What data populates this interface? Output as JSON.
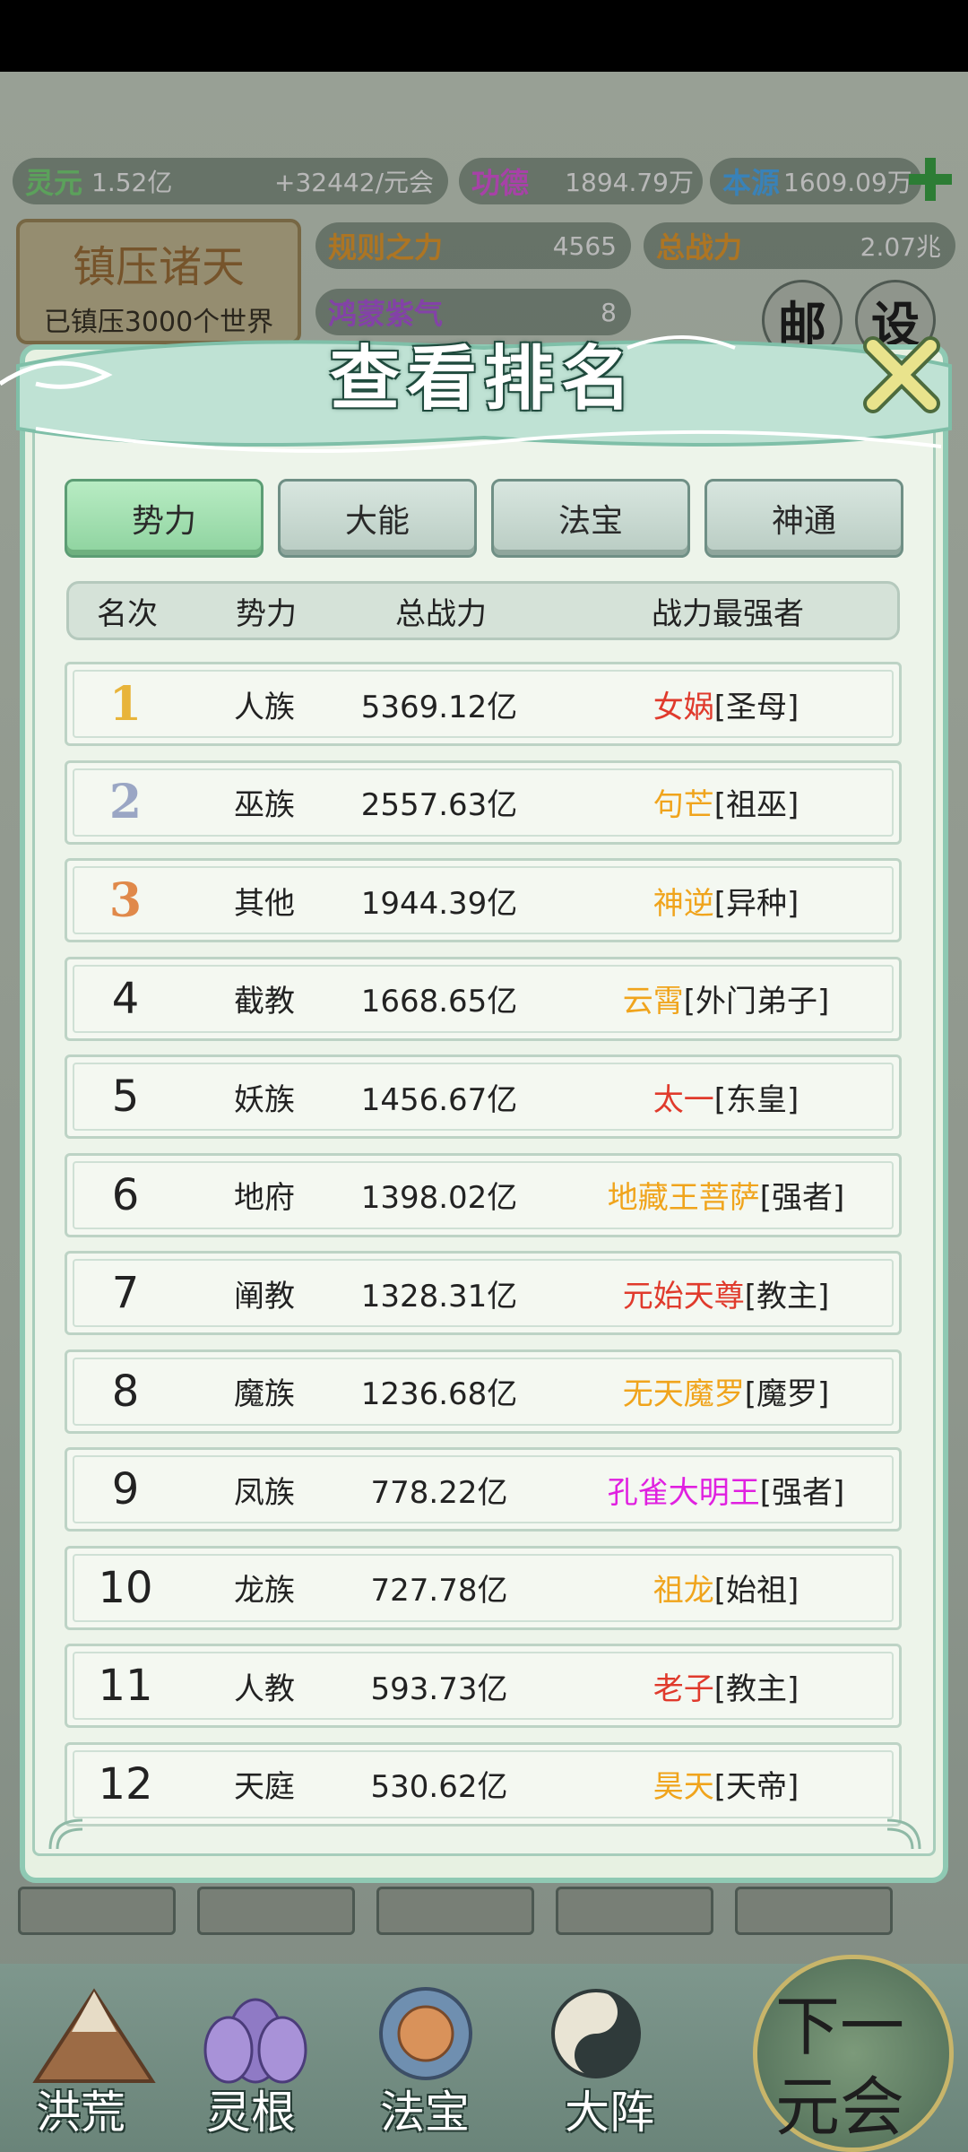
{
  "top_stats": {
    "lingyuan_label": "灵元",
    "lingyuan_value": "1.52亿",
    "lingyuan_rate": "+32442/元会",
    "gongde_label": "功德",
    "gongde_value": "1894.79万",
    "benyuan_label": "本源",
    "benyuan_value": "1609.09万",
    "guize_label": "规则之力",
    "guize_value": "4565",
    "zongzhanli_label": "总战力",
    "zongzhanli_value": "2.07兆",
    "hongmeng_label": "鸿蒙紫气",
    "hongmeng_value": "8"
  },
  "suppress_panel": {
    "title": "镇压诸天",
    "subtitle": "已镇压3000个世界"
  },
  "round_buttons": {
    "mail": "邮",
    "settings": "设"
  },
  "modal": {
    "title": "查看排名",
    "tabs": [
      "势力",
      "大能",
      "法宝",
      "神通"
    ],
    "active_tab": 0,
    "headers": {
      "rank": "名次",
      "force": "势力",
      "power": "总战力",
      "strongest": "战力最强者"
    },
    "rows": [
      {
        "rank": "1",
        "force": "人族",
        "power": "5369.12亿",
        "name": "女娲",
        "title": "[圣母]",
        "color": "#e03a2c"
      },
      {
        "rank": "2",
        "force": "巫族",
        "power": "2557.63亿",
        "name": "句芒",
        "title": "[祖巫]",
        "color": "#f0a41c"
      },
      {
        "rank": "3",
        "force": "其他",
        "power": "1944.39亿",
        "name": "神逆",
        "title": "[异种]",
        "color": "#f0a41c"
      },
      {
        "rank": "4",
        "force": "截教",
        "power": "1668.65亿",
        "name": "云霄",
        "title": "[外门弟子]",
        "color": "#f0a41c"
      },
      {
        "rank": "5",
        "force": "妖族",
        "power": "1456.67亿",
        "name": "太一",
        "title": "[东皇]",
        "color": "#e03a2c"
      },
      {
        "rank": "6",
        "force": "地府",
        "power": "1398.02亿",
        "name": "地藏王菩萨",
        "title": "[强者]",
        "color": "#f0a41c"
      },
      {
        "rank": "7",
        "force": "阐教",
        "power": "1328.31亿",
        "name": "元始天尊",
        "title": "[教主]",
        "color": "#e03a2c"
      },
      {
        "rank": "8",
        "force": "魔族",
        "power": "1236.68亿",
        "name": "无天魔罗",
        "title": "[魔罗]",
        "color": "#f0a41c"
      },
      {
        "rank": "9",
        "force": "凤族",
        "power": "778.22亿",
        "name": "孔雀大明王",
        "title": "[强者]",
        "color": "#e020e0"
      },
      {
        "rank": "10",
        "force": "龙族",
        "power": "727.78亿",
        "name": "祖龙",
        "title": "[始祖]",
        "color": "#f0a41c"
      },
      {
        "rank": "11",
        "force": "人教",
        "power": "593.73亿",
        "name": "老子",
        "title": "[教主]",
        "color": "#e03a2c"
      },
      {
        "rank": "12",
        "force": "天庭",
        "power": "530.62亿",
        "name": "昊天",
        "title": "[天帝]",
        "color": "#f0a41c"
      }
    ],
    "medal_colors": [
      "#e8b43a",
      "#9aa6c4",
      "#e0894a"
    ]
  },
  "bottom_nav": {
    "items": [
      "洪荒",
      "灵根",
      "法宝",
      "大阵"
    ],
    "next_button": [
      "下一",
      "元会"
    ]
  }
}
